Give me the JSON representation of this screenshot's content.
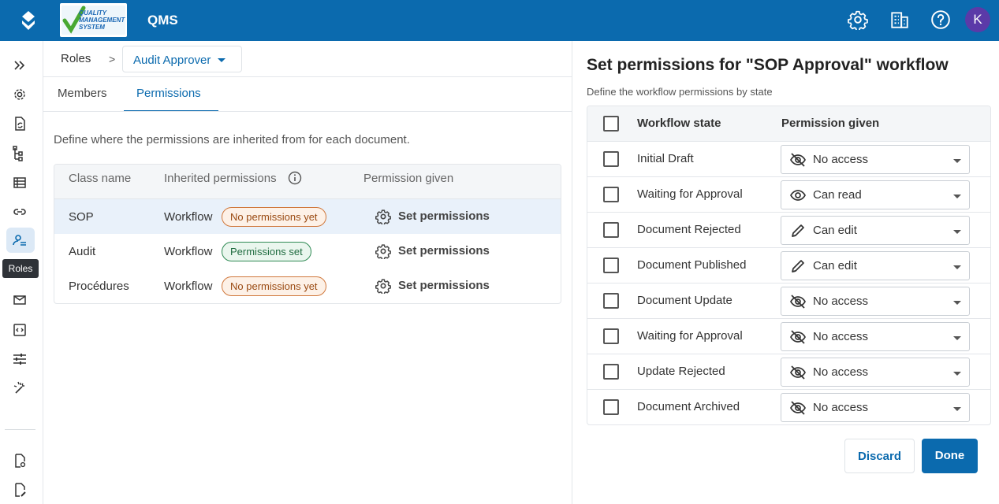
{
  "header": {
    "app_title": "QMS",
    "logo_text_1": "QUALITY",
    "logo_text_2": "MANAGEMENT",
    "logo_text_3": "SYSTEM",
    "avatar_initial": "K",
    "icons": [
      "settings-gear-icon",
      "building-icon",
      "help-icon"
    ]
  },
  "sidebar": {
    "tooltip": "Roles",
    "icons": [
      "expand-icon",
      "settings-icon",
      "document-sync-icon",
      "hierarchy-icon",
      "list-icon",
      "link-icon",
      "roles-icon",
      "mail-icon",
      "code-icon",
      "sliders-icon",
      "magic-wand-icon",
      "document-settings-icon",
      "document-edit-icon"
    ]
  },
  "main": {
    "breadcrumb_root": "Roles",
    "breadcrumb_sep": ">",
    "role_selected": "Audit Approver",
    "tabs": [
      {
        "label": "Members"
      },
      {
        "label": "Permissions"
      }
    ],
    "description": "Define where the permissions are inherited from for each document.",
    "table": {
      "headers": [
        "Class name",
        "Inherited permissions",
        "Permission given"
      ],
      "rows": [
        {
          "class_name": "SOP",
          "inherited": "Workflow",
          "badge": "No permissions yet",
          "action": "Set permissions"
        },
        {
          "class_name": "Audit",
          "inherited": "Workflow",
          "badge": "Permissions set",
          "action": "Set permissions"
        },
        {
          "class_name": "Procédures",
          "inherited": "Workflow",
          "badge": "No permissions yet",
          "action": "Set permissions"
        }
      ]
    }
  },
  "panel": {
    "title": "Set permissions for \"SOP Approval\" workflow",
    "subtitle": "Define the workflow permissions by state",
    "headers": [
      "Workflow state",
      "Permission given"
    ],
    "rows": [
      {
        "state": "Initial Draft",
        "permission": "No access",
        "icon": "eye-off-icon"
      },
      {
        "state": "Waiting for Approval",
        "permission": "Can read",
        "icon": "eye-icon"
      },
      {
        "state": "Document Rejected",
        "permission": "Can edit",
        "icon": "pencil-icon"
      },
      {
        "state": "Document Published",
        "permission": "Can edit",
        "icon": "pencil-icon"
      },
      {
        "state": "Document Update",
        "permission": "No access",
        "icon": "eye-off-icon"
      },
      {
        "state": "Waiting for Approval",
        "permission": "No access",
        "icon": "eye-off-icon"
      },
      {
        "state": "Update Rejected",
        "permission": "No access",
        "icon": "eye-off-icon"
      },
      {
        "state": "Document Archived",
        "permission": "No access",
        "icon": "eye-off-icon"
      }
    ],
    "discard_label": "Discard",
    "done_label": "Done"
  },
  "colors": {
    "brand": "#0b6aae",
    "avatar": "#5b3aa8",
    "warn_badge": "#d0783c",
    "ok_badge": "#2f8a54"
  }
}
